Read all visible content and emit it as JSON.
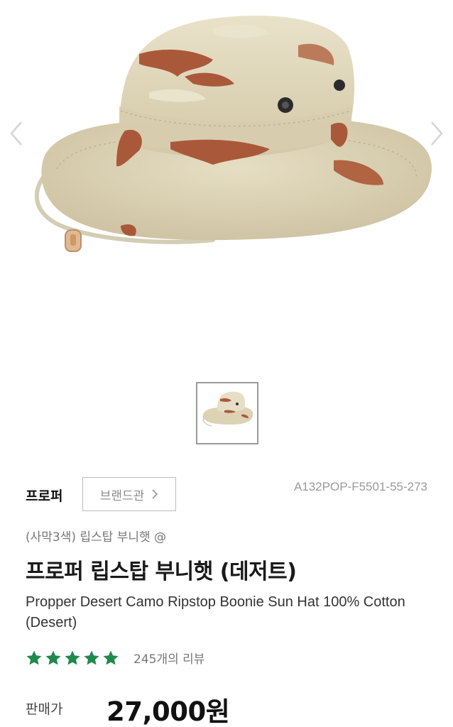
{
  "gallery": {
    "image_alt": "Desert camo boonie hat",
    "prev_icon": "chevron-left-icon",
    "next_icon": "chevron-right-icon"
  },
  "product": {
    "brand": "프로퍼",
    "brand_shop_label": "브랜드관",
    "sku": "A132POP-F5501-55-273",
    "subtitle": "(사막3색) 립스탑 부니햇 @",
    "title": "프로퍼 립스탑 부니햇 (데저트)",
    "english_title": "Propper Desert Camo Ripstop Boonie Sun Hat 100% Cotton (Desert)",
    "rating_stars": 5,
    "review_count": "245개의 리뷰",
    "price_label": "판매가",
    "price": "27,000원"
  },
  "colors": {
    "star": "#1f8a4c",
    "camo_base": "#dcd2b4",
    "camo_brown": "#a9593a",
    "camo_light": "#ebe4cc"
  }
}
